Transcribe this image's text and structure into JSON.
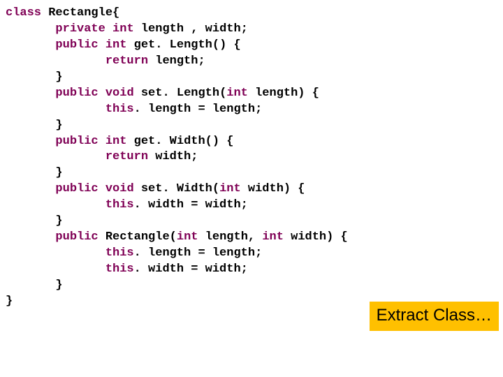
{
  "kw": {
    "class": "class",
    "private": "private",
    "int": "int",
    "public": "public",
    "void": "void",
    "return": "return",
    "this": "this"
  },
  "id": {
    "Rectangle": "Rectangle",
    "declFields": "length , width;",
    "getLength": "get. Length() {",
    "retLength": "length;",
    "setLength": "set. Length(",
    "paramLength": "length) {",
    "assignLength": ". length = length;",
    "getWidth": "get. Width() {",
    "retWidth": "width;",
    "setWidth": "set. Width(",
    "paramWidth": "width) {",
    "assignWidth": ". width = width;",
    "ctorName": "Rectangle(",
    "ctorLenComma": "length, ",
    "ctorWidth": "width) {",
    "closeBrace": "}",
    "openBrace": "{"
  },
  "callout": "Extract Class…"
}
